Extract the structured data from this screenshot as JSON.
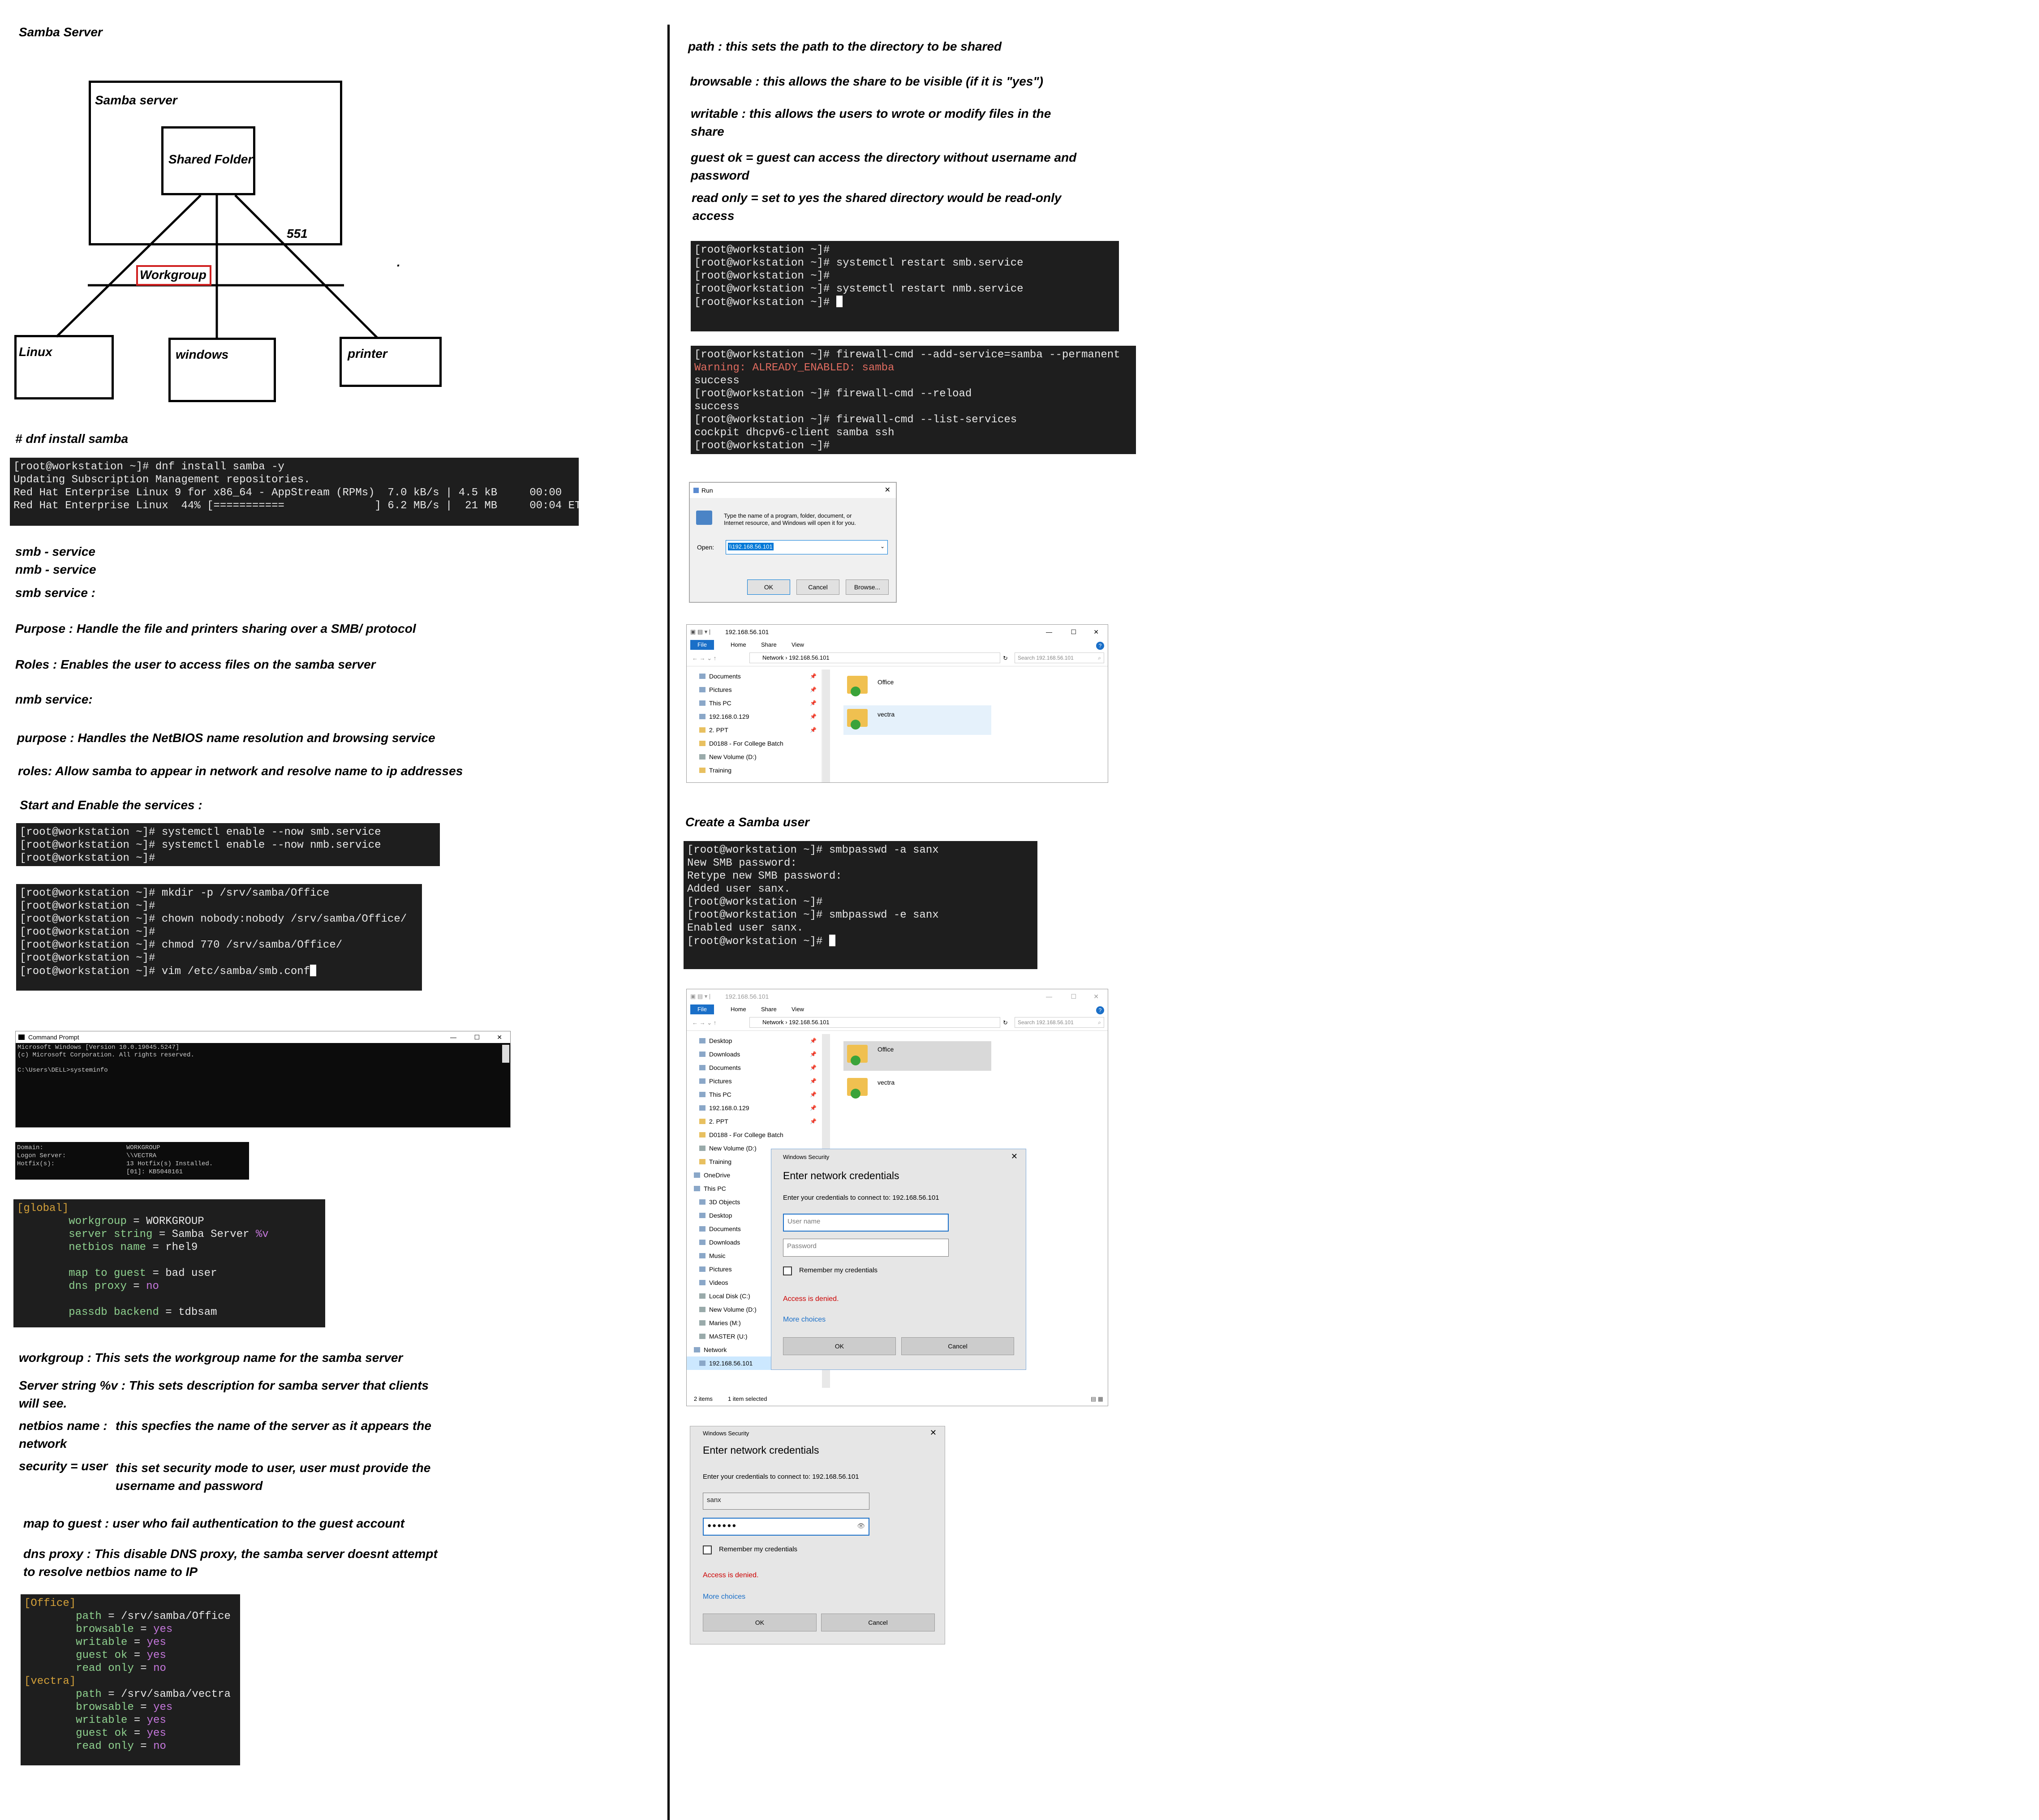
{
  "left": {
    "title": "Samba Server",
    "diagram": {
      "server_label": "Samba server",
      "shared_label": "Shared Folder",
      "num_label": "551",
      "workgroup_label": "Workgroup",
      "client1": "Linux",
      "client2": "windows",
      "client3": "printer",
      "dot": "."
    },
    "install_heading": "# dnf install samba",
    "install_term": [
      "[root@workstation ~]# dnf install samba -y",
      "Updating Subscription Management repositories.",
      "Red Hat Enterprise Linux 9 for x86_64 - AppStream (RPMs)  7.0 kB/s | 4.5 kB     00:00    A",
      "Red Hat Enterprise Linux  44% [===========              ] 6.2 MB/s |  21 MB     00:04 ETA"
    ],
    "notes1": {
      "smb_service": "smb - service",
      "nmb_service": "nmb - service",
      "smb_heading": "smb service :",
      "smb_purpose": "Purpose : Handle the file and printers sharing over a SMB/ protocol",
      "smb_roles": "Roles : Enables the user to access files on the samba server",
      "nmb_heading": "nmb service:",
      "nmb_purpose": "purpose : Handles the NetBIOS name resolution and browsing service",
      "nmb_roles": "roles: Allow samba to appear in network and resolve name to ip addresses",
      "start_enable": "Start and Enable the services :"
    },
    "enable_term": [
      "[root@workstation ~]# systemctl enable --now smb.service",
      "[root@workstation ~]# systemctl enable --now nmb.service",
      "[root@workstation ~]#"
    ],
    "mkdir_term": [
      "[root@workstation ~]# mkdir -p /srv/samba/Office",
      "[root@workstation ~]#",
      "[root@workstation ~]# chown nobody:nobody /srv/samba/Office/",
      "[root@workstation ~]#",
      "[root@workstation ~]# chmod 770 /srv/samba/Office/",
      "[root@workstation ~]#",
      "[root@workstation ~]# vim /etc/samba/smb.conf"
    ],
    "cmd_window": {
      "title": "Command Prompt",
      "lines": [
        "Microsoft Windows [Version 10.0.19045.5247]",
        "(c) Microsoft Corporation. All rights reserved.",
        "",
        "C:\\Users\\DELL>systeminfo"
      ]
    },
    "sysinfo": [
      [
        "Domain:",
        "WORKGROUP"
      ],
      [
        "Logon Server:",
        "\\\\VECTRA"
      ],
      [
        "Hotfix(s):",
        "13 Hotfix(s) Installed."
      ],
      [
        "",
        "[01]: KB5048161"
      ]
    ],
    "global_conf": {
      "section": "[global]",
      "entries": [
        {
          "key": "workgroup",
          "value": "WORKGROUP",
          "kw": false
        },
        {
          "key": "server string",
          "value": "Samba Server",
          "extra": "%v",
          "kw": false
        },
        {
          "key": "netbios name",
          "value": "rhel9",
          "kw": false
        },
        {
          "key": "",
          "value": "",
          "kw": false
        },
        {
          "key": "map to guest",
          "value": "bad user",
          "kw": false
        },
        {
          "key": "dns proxy",
          "value": "no",
          "kw": true
        },
        {
          "key": "",
          "value": "",
          "kw": false
        },
        {
          "key": "passdb backend",
          "value": "tdbsam",
          "kw": false
        }
      ]
    },
    "notes2": {
      "workgroup": "workgroup : This sets the workgroup name for the samba server",
      "server_string_1": "Server string %v : This sets description for samba server that clients",
      "server_string_2": "will see.",
      "netbios_label": "netbios name :",
      "netbios_1": "this specfies the name of the server as it appears the",
      "netbios_2": "network",
      "security_label": "security = user",
      "security_1": "this set security mode to user, user must provide the",
      "security_2": "username and password",
      "map_guest": "map to guest : user who fail authentication to the guest account",
      "dns_1": "dns proxy : This disable DNS proxy, the samba server doesnt attempt",
      "dns_2": "to resolve netbios name to IP"
    },
    "share_conf": [
      {
        "section": "[Office]",
        "entries": [
          {
            "key": "path",
            "value": "/srv/samba/Office",
            "kw": false
          },
          {
            "key": "browsable",
            "value": "yes",
            "kw": true
          },
          {
            "key": "writable",
            "value": "yes",
            "kw": true
          },
          {
            "key": "guest ok",
            "value": "yes",
            "kw": true
          },
          {
            "key": "read only",
            "value": "no",
            "kw": true
          }
        ]
      },
      {
        "section": "[vectra]",
        "entries": [
          {
            "key": "path",
            "value": "/srv/samba/vectra",
            "kw": false
          },
          {
            "key": "browsable",
            "value": "yes",
            "kw": true
          },
          {
            "key": "writable",
            "value": "yes",
            "kw": true
          },
          {
            "key": "guest ok",
            "value": "yes",
            "kw": true
          },
          {
            "key": "read only",
            "value": "no",
            "kw": true
          }
        ]
      }
    ]
  },
  "right": {
    "notes": {
      "path": "path : this sets the path to the directory to be shared",
      "browsable": "browsable : this allows the share to be visible (if it is \"yes\")",
      "writable_1": "writable : this allows the users to wrote or modify files in the",
      "writable_2": "share",
      "guest_1": "guest ok = guest can access the directory without username and",
      "guest_2": "password",
      "readonly_1": "read only = set to yes the shared directory would be read-only",
      "readonly_2": "access"
    },
    "restart_term": [
      "[root@workstation ~]#",
      "[root@workstation ~]# systemctl restart smb.service",
      "[root@workstation ~]#",
      "[root@workstation ~]# systemctl restart nmb.service",
      "[root@workstation ~]# "
    ],
    "firewall_term": [
      {
        "text": "[root@workstation ~]# firewall-cmd --add-service=samba --permanent",
        "warn": false
      },
      {
        "text": "Warning: ALREADY_ENABLED: samba",
        "warn": true
      },
      {
        "text": "success",
        "warn": false
      },
      {
        "text": "[root@workstation ~]# firewall-cmd --reload",
        "warn": false
      },
      {
        "text": "success",
        "warn": false
      },
      {
        "text": "[root@workstation ~]# firewall-cmd --list-services",
        "warn": false
      },
      {
        "text": "cockpit dhcpv6-client samba ssh",
        "warn": false
      },
      {
        "text": "[root@workstation ~]#",
        "warn": false
      }
    ],
    "run_dialog": {
      "title": "Run",
      "desc_1": "Type the name of a program, folder, document, or",
      "desc_2": "Internet resource, and Windows will open it for you.",
      "open_label": "Open:",
      "open_value": "\\\\192.168.56.101",
      "ok": "OK",
      "cancel": "Cancel",
      "browse": "Browse..."
    },
    "explorer1": {
      "title": "192.168.56.101",
      "tabs": [
        "File",
        "Home",
        "Share",
        "View"
      ],
      "path_network": "Network",
      "path_host": "192.168.56.101",
      "search": "Search 192.168.56.101",
      "sidebar": [
        "Documents",
        "Pictures",
        "This PC",
        "192.168.0.129",
        "2. PPT",
        "D0188 - For College Batch",
        "New Volume (D:)",
        "Training"
      ],
      "folders": [
        "Office",
        "vectra"
      ]
    },
    "create_user": "Create a Samba user",
    "smbpasswd_term": [
      "[root@workstation ~]# smbpasswd -a sanx",
      "New SMB password:",
      "Retype new SMB password:",
      "Added user sanx.",
      "[root@workstation ~]#",
      "[root@workstation ~]# smbpasswd -e sanx",
      "Enabled user sanx.",
      "[root@workstation ~]# "
    ],
    "explorer2": {
      "title": "192.168.56.101",
      "tabs": [
        "File",
        "Home",
        "Share",
        "View"
      ],
      "path_network": "Network",
      "path_host": "192.168.56.101",
      "search": "Search 192.168.56.101",
      "sidebar": [
        "Desktop",
        "Downloads",
        "Documents",
        "Pictures",
        "This PC",
        "192.168.0.129",
        "2. PPT",
        "D0188 - For College Batch",
        "New Volume (D:)",
        "Training",
        "OneDrive",
        "This PC",
        "3D Objects",
        "Desktop",
        "Documents",
        "Downloads",
        "Music",
        "Pictures",
        "Videos",
        "Local Disk (C:)",
        "New Volume (D:)",
        "Maries (M:)",
        "MASTER (U:)",
        "Network",
        "192.168.56.101"
      ],
      "folders": [
        "Office",
        "vectra"
      ],
      "status_items": "2 items",
      "status_selected": "1 item selected"
    },
    "security1": {
      "title": "Windows Security",
      "heading": "Enter network credentials",
      "desc": "Enter your credentials to connect to: 192.168.56.101",
      "user_placeholder": "User name",
      "pass_placeholder": "Password",
      "remember": "Remember my credentials",
      "denied": "Access is denied.",
      "more": "More choices",
      "ok": "OK",
      "cancel": "Cancel"
    },
    "security2": {
      "title": "Windows Security",
      "heading": "Enter network credentials",
      "desc": "Enter your credentials to connect to: 192.168.56.101",
      "user_value": "sanx",
      "pass_value": "●●●●●●",
      "remember": "Remember my credentials",
      "denied": "Access is denied.",
      "more": "More choices",
      "ok": "OK",
      "cancel": "Cancel"
    }
  }
}
